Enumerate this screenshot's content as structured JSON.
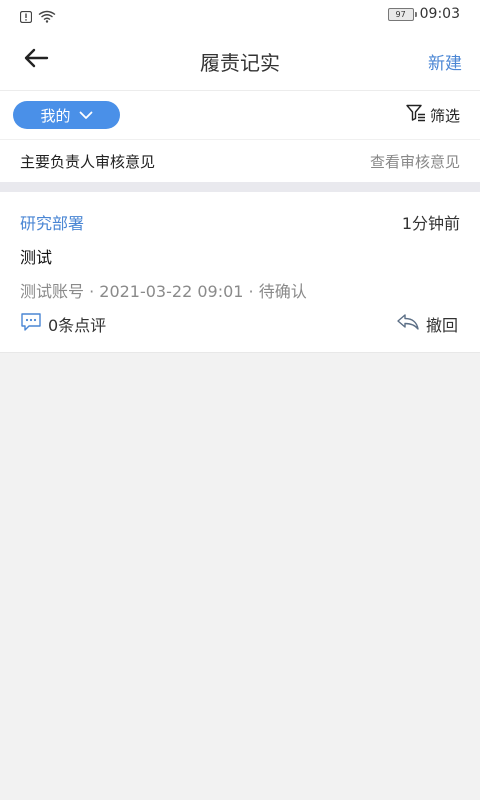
{
  "status_bar": {
    "battery": "97",
    "time": "09:03"
  },
  "header": {
    "title": "履责记实",
    "new_label": "新建"
  },
  "filter": {
    "mine_label": "我的",
    "filter_label": "筛选"
  },
  "review": {
    "title": "主要负责人审核意见",
    "link": "查看审核意见"
  },
  "records": [
    {
      "department": "研究部署",
      "time_ago": "1分钟前",
      "title": "测试",
      "meta": "测试账号 · 2021-03-22 09:01 · 待确认",
      "comments": "0条点评",
      "withdraw": "撤回"
    }
  ],
  "colors": {
    "accent": "#4a86d4",
    "pill": "#4a90e8"
  },
  "icons": {
    "back": "arrow-left-icon",
    "dropdown": "chevron-down-icon",
    "filter": "filter-icon",
    "comment": "comment-icon",
    "withdraw": "reply-icon"
  }
}
